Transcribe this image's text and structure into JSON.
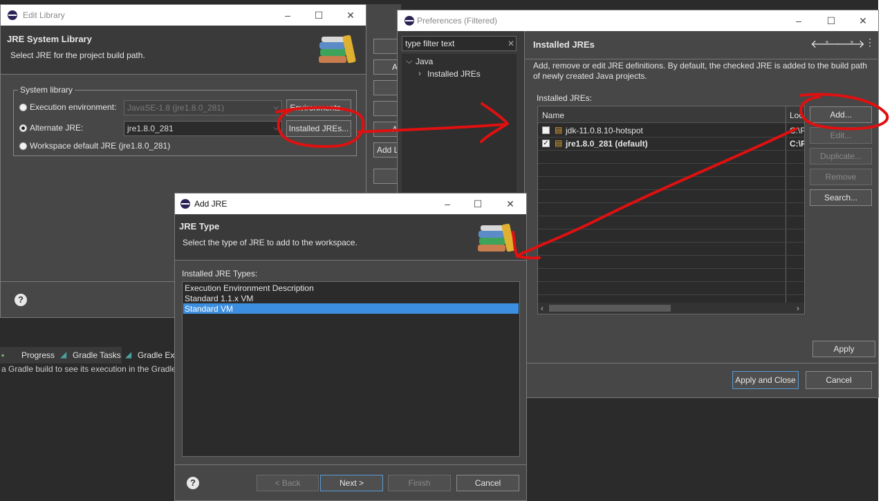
{
  "edit_library": {
    "title": "Edit Library",
    "heading": "JRE System Library",
    "description": "Select JRE for the project build path.",
    "group_label": "System library",
    "exec_env_label": "Execution environment:",
    "exec_env_value": "JavaSE-1.8 (jre1.8.0_281)",
    "environments_button": "Environments...",
    "alt_jre_label": "Alternate JRE:",
    "alt_jre_value": "jre1.8.0_281",
    "installed_jres_button": "Installed JREs...",
    "workspace_default_label": "Workspace default JRE (jre1.8.0_281)",
    "selected_option": "alternate_jre"
  },
  "background_views": {
    "tabs": [
      {
        "label": "Progress"
      },
      {
        "label": "Gradle Tasks"
      },
      {
        "label": "Gradle Exe"
      }
    ],
    "message": "a Gradle build to see its execution in the Gradle",
    "partial_buttons": [
      "A",
      "A",
      "Add L"
    ]
  },
  "preferences": {
    "title": "Preferences (Filtered)",
    "filter_placeholder": "type filter text",
    "tree": {
      "root": "Java",
      "child": "Installed JREs"
    },
    "page_title": "Installed JREs",
    "description": "Add, remove or edit JRE definitions. By default, the checked JRE is added to the build path of newly created Java projects.",
    "table_label": "Installed JREs:",
    "columns": [
      "Name",
      "Loc"
    ],
    "rows": [
      {
        "name": "jdk-11.0.8.10-hotspot",
        "location": "C:\\P",
        "checked": false,
        "bold": false
      },
      {
        "name": "jre1.8.0_281 (default)",
        "location": "C:\\P",
        "checked": true,
        "bold": true
      }
    ],
    "side_buttons": {
      "add": "Add...",
      "edit": "Edit...",
      "duplicate": "Duplicate...",
      "remove": "Remove",
      "search": "Search..."
    },
    "apply": "Apply",
    "apply_close": "Apply and Close",
    "cancel": "Cancel"
  },
  "add_jre": {
    "title": "Add JRE",
    "heading": "JRE Type",
    "description": "Select the type of JRE to add to the workspace.",
    "list_label": "Installed JRE Types:",
    "types": [
      {
        "label": "Execution Environment Description",
        "selected": false
      },
      {
        "label": "Standard 1.1.x VM",
        "selected": false
      },
      {
        "label": "Standard VM",
        "selected": true
      }
    ],
    "back": "< Back",
    "next": "Next >",
    "finish": "Finish",
    "cancel": "Cancel"
  },
  "colors": {
    "dialog_bg": "#474747",
    "dark_bg": "#2f2f2f",
    "selection": "#3c8fe0",
    "annotation": "#e01010"
  }
}
